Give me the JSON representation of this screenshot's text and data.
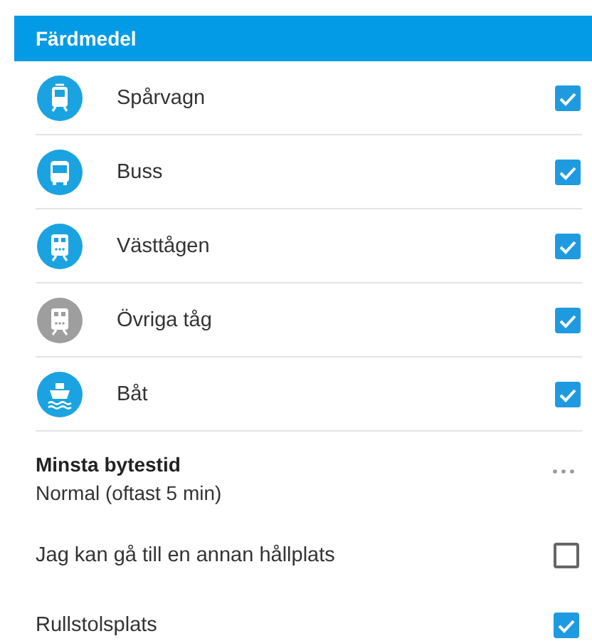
{
  "section": {
    "title": "Färdmedel"
  },
  "modes": [
    {
      "label": "Spårvagn",
      "kind": "tram",
      "color": "#1aa3e0",
      "checked": true
    },
    {
      "label": "Buss",
      "kind": "bus",
      "color": "#1aa3e0",
      "checked": true
    },
    {
      "label": "Västtågen",
      "kind": "train",
      "color": "#1aa3e0",
      "checked": true
    },
    {
      "label": "Övriga tåg",
      "kind": "train",
      "color": "#9e9e9e",
      "checked": true
    },
    {
      "label": "Båt",
      "kind": "boat",
      "color": "#1aa3e0",
      "checked": true
    }
  ],
  "transfer": {
    "title": "Minsta bytestid",
    "value": "Normal (oftast 5 min)"
  },
  "options": [
    {
      "label": "Jag kan gå till en annan hållplats",
      "checked": false
    },
    {
      "label": "Rullstolsplats",
      "checked": true
    }
  ]
}
